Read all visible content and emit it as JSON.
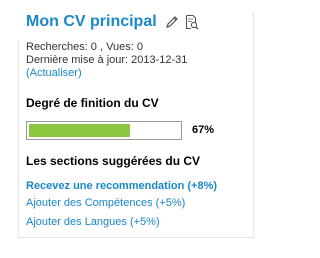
{
  "header": {
    "title": "Mon CV principal",
    "icons": [
      "pencil-icon",
      "document-search-icon"
    ]
  },
  "stats": {
    "searches_views": "Recherches: 0 , Vues: 0",
    "last_update": "Dernière mise à jour:  2013-12-31",
    "refresh_link": "(Actualiser)"
  },
  "completion": {
    "heading": "Degré de finition du CV",
    "percent": 67,
    "percent_label": "67%",
    "fill_color": "#8dc63f"
  },
  "suggestions": {
    "heading": "Les sections suggérées du CV",
    "items": [
      {
        "label": "Recevez une recommendation (+8%)"
      },
      {
        "label": "Ajouter des Compétences (+5%)"
      },
      {
        "label": "Ajouter des Langues (+5%)"
      }
    ]
  },
  "colors": {
    "link": "#1a87c9",
    "progress": "#8dc63f"
  }
}
